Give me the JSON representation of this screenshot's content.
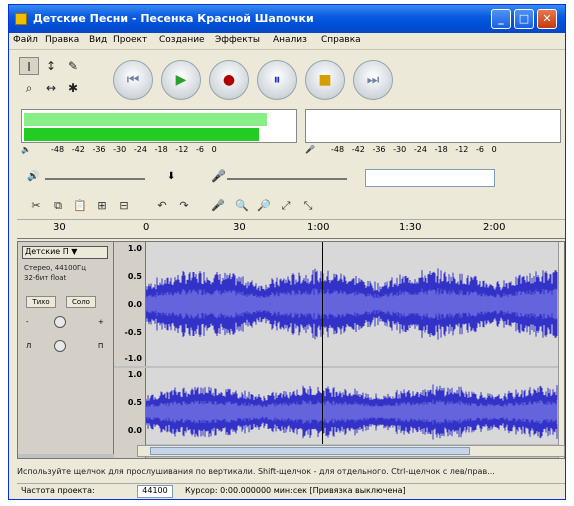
{
  "window": {
    "title": "Детские Песни - Песенка Красной Шапочки",
    "minimize": "_",
    "maximize": "□",
    "close": "✕"
  },
  "menu": [
    "Файл",
    "Правка",
    "Вид",
    "Проект",
    "Создание",
    "Эффекты",
    "Анализ",
    "Справка"
  ],
  "tools": {
    "selection": "I",
    "envelope": "↕",
    "draw": "✎",
    "zoom": "⌕",
    "timeshift": "↔",
    "multi": "✱"
  },
  "transport": {
    "rewind": "⏮",
    "play": "▶",
    "record": "●",
    "pause": "⏸",
    "stop": "■",
    "forward": "⏭"
  },
  "meters": {
    "play_scale": [
      "-48",
      "-42",
      "-36",
      "-30",
      "-24",
      "-18",
      "-12",
      "-6",
      "0"
    ],
    "rec_scale": [
      "-48",
      "-42",
      "-36",
      "-30",
      "-24",
      "-18",
      "-12",
      "-6",
      "0"
    ],
    "play_level_left": 0.88,
    "play_level_right": 0.85
  },
  "edit_tools": [
    "✂",
    "⧉",
    "📋",
    "⊞",
    "⊟",
    "↶",
    "↷",
    "🎤",
    "🔍",
    "🔎",
    "⤢",
    "⤡"
  ],
  "ruler": {
    "ticks": [
      "30",
      "0",
      "30",
      "1:00",
      "1:30",
      "2:00"
    ]
  },
  "track": {
    "name": "Детские П ▼",
    "info_lines": [
      "Стерео, 44100Гц",
      "32-бит float"
    ],
    "mute": "Тихо",
    "solo": "Соло",
    "gain_minus": "-",
    "gain_plus": "+",
    "pan_left": "Л",
    "pan_right": "П",
    "vlabels_top": [
      "1.0",
      "0.5",
      "0.0",
      "-0.5",
      "-1.0"
    ],
    "vlabels_bottom": [
      "1.0",
      "0.5",
      "0.0"
    ]
  },
  "status": {
    "message": "Используйте щелчок для прослушивания по вертикали. Shift-щелчок - для отдельного. Ctrl-щелчок с лев/прав...",
    "rate_label": "Частота проекта:",
    "rate_value": "44100",
    "cursor": "Курсор: 0:00.000000 мин:сек   [Привязка выключена]"
  },
  "colors": {
    "titlebar": "#0a5ce0",
    "waveform": "#3232c8",
    "waveform_rms": "#6464dc",
    "meter_green": "#22cc22",
    "play_icon": "#2aa02a",
    "record_icon": "#b00000",
    "pause_icon": "#2030c0",
    "stop_icon": "#d4a000"
  }
}
